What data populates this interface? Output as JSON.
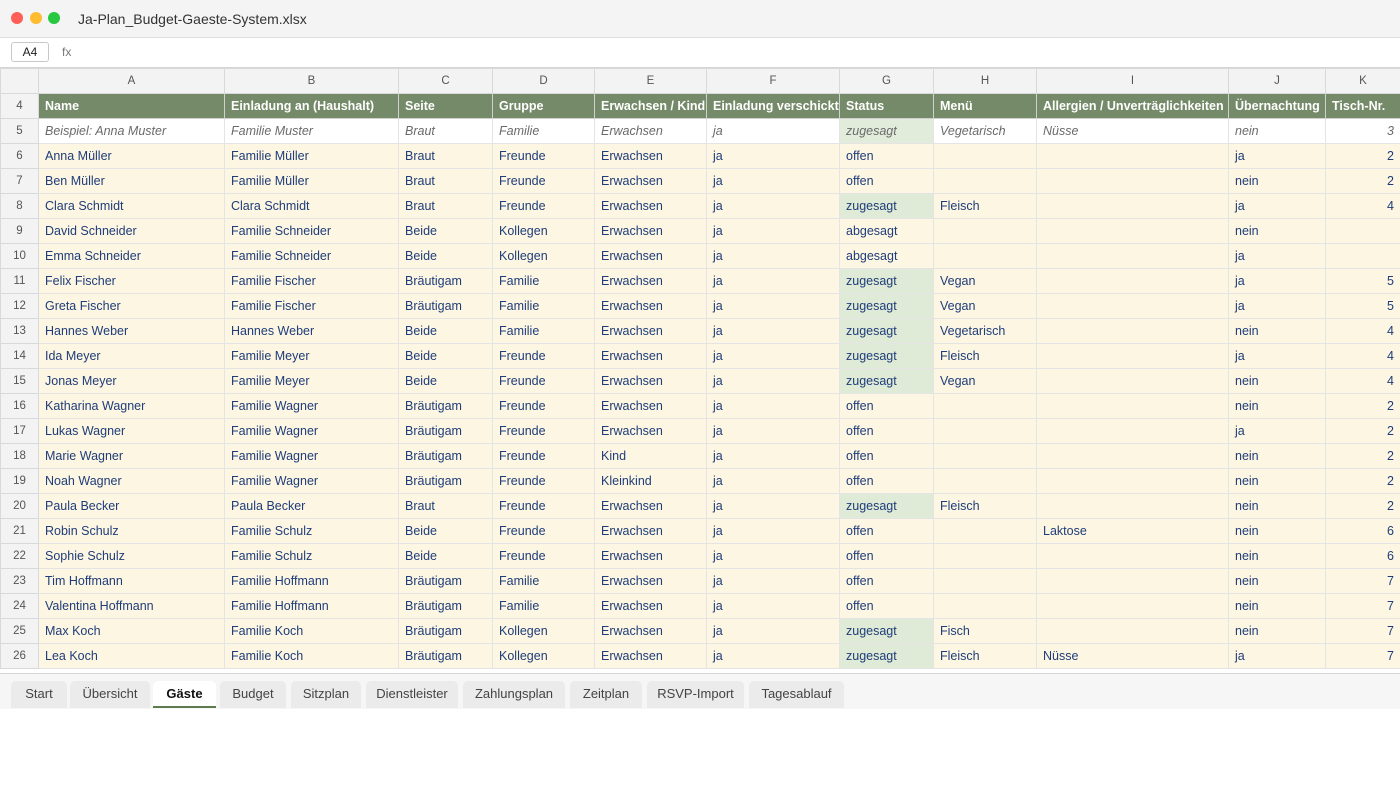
{
  "window": {
    "title": "Ja-Plan_Budget-Gaeste-System.xlsx"
  },
  "formula_bar": {
    "cell_ref": "A4",
    "fx_label": "fx"
  },
  "columns": [
    "A",
    "B",
    "C",
    "D",
    "E",
    "F",
    "G",
    "H",
    "I",
    "J",
    "K"
  ],
  "header_row": {
    "row_number": "4",
    "cells": [
      "Name",
      "Einladung an (Haushalt)",
      "Seite",
      "Gruppe",
      "Erwachsen / Kind",
      "Einladung verschickt",
      "Status",
      "Menü",
      "Allergien / Unverträglichkeiten",
      "Übernachtung",
      "Tisch-Nr."
    ]
  },
  "example_row": {
    "row_number": "5",
    "cells": [
      "Beispiel: Anna Muster",
      "Familie Muster",
      "Braut",
      "Familie",
      "Erwachsen",
      "ja",
      "zugesagt",
      "Vegetarisch",
      "Nüsse",
      "nein",
      "3"
    ]
  },
  "rows": [
    {
      "n": "6",
      "cells": [
        "Anna Müller",
        "Familie Müller",
        "Braut",
        "Freunde",
        "Erwachsen",
        "ja",
        "offen",
        "",
        "",
        "ja",
        "2"
      ]
    },
    {
      "n": "7",
      "cells": [
        "Ben Müller",
        "Familie Müller",
        "Braut",
        "Freunde",
        "Erwachsen",
        "ja",
        "offen",
        "",
        "",
        "nein",
        "2"
      ]
    },
    {
      "n": "8",
      "cells": [
        "Clara Schmidt",
        "Clara Schmidt",
        "Braut",
        "Freunde",
        "Erwachsen",
        "ja",
        "zugesagt",
        "Fleisch",
        "",
        "ja",
        "4"
      ]
    },
    {
      "n": "9",
      "cells": [
        "David Schneider",
        "Familie Schneider",
        "Beide",
        "Kollegen",
        "Erwachsen",
        "ja",
        "abgesagt",
        "",
        "",
        "nein",
        ""
      ]
    },
    {
      "n": "10",
      "cells": [
        "Emma Schneider",
        "Familie Schneider",
        "Beide",
        "Kollegen",
        "Erwachsen",
        "ja",
        "abgesagt",
        "",
        "",
        "ja",
        ""
      ]
    },
    {
      "n": "11",
      "cells": [
        "Felix Fischer",
        "Familie Fischer",
        "Bräutigam",
        "Familie",
        "Erwachsen",
        "ja",
        "zugesagt",
        "Vegan",
        "",
        "ja",
        "5"
      ]
    },
    {
      "n": "12",
      "cells": [
        "Greta Fischer",
        "Familie Fischer",
        "Bräutigam",
        "Familie",
        "Erwachsen",
        "ja",
        "zugesagt",
        "Vegan",
        "",
        "ja",
        "5"
      ]
    },
    {
      "n": "13",
      "cells": [
        "Hannes Weber",
        "Hannes Weber",
        "Beide",
        "Familie",
        "Erwachsen",
        "ja",
        "zugesagt",
        "Vegetarisch",
        "",
        "nein",
        "4"
      ]
    },
    {
      "n": "14",
      "cells": [
        "Ida Meyer",
        "Familie Meyer",
        "Beide",
        "Freunde",
        "Erwachsen",
        "ja",
        "zugesagt",
        "Fleisch",
        "",
        "ja",
        "4"
      ]
    },
    {
      "n": "15",
      "cells": [
        "Jonas Meyer",
        "Familie Meyer",
        "Beide",
        "Freunde",
        "Erwachsen",
        "ja",
        "zugesagt",
        "Vegan",
        "",
        "nein",
        "4"
      ]
    },
    {
      "n": "16",
      "cells": [
        "Katharina Wagner",
        "Familie Wagner",
        "Bräutigam",
        "Freunde",
        "Erwachsen",
        "ja",
        "offen",
        "",
        "",
        "nein",
        "2"
      ]
    },
    {
      "n": "17",
      "cells": [
        "Lukas Wagner",
        "Familie Wagner",
        "Bräutigam",
        "Freunde",
        "Erwachsen",
        "ja",
        "offen",
        "",
        "",
        "ja",
        "2"
      ]
    },
    {
      "n": "18",
      "cells": [
        "Marie Wagner",
        "Familie Wagner",
        "Bräutigam",
        "Freunde",
        "Kind",
        "ja",
        "offen",
        "",
        "",
        "nein",
        "2"
      ]
    },
    {
      "n": "19",
      "cells": [
        "Noah Wagner",
        "Familie Wagner",
        "Bräutigam",
        "Freunde",
        "Kleinkind",
        "ja",
        "offen",
        "",
        "",
        "nein",
        "2"
      ]
    },
    {
      "n": "20",
      "cells": [
        "Paula Becker",
        "Paula Becker",
        "Braut",
        "Freunde",
        "Erwachsen",
        "ja",
        "zugesagt",
        "Fleisch",
        "",
        "nein",
        "2"
      ]
    },
    {
      "n": "21",
      "cells": [
        "Robin Schulz",
        "Familie Schulz",
        "Beide",
        "Freunde",
        "Erwachsen",
        "ja",
        "offen",
        "",
        "Laktose",
        "nein",
        "6"
      ]
    },
    {
      "n": "22",
      "cells": [
        "Sophie Schulz",
        "Familie Schulz",
        "Beide",
        "Freunde",
        "Erwachsen",
        "ja",
        "offen",
        "",
        "",
        "nein",
        "6"
      ]
    },
    {
      "n": "23",
      "cells": [
        "Tim Hoffmann",
        "Familie Hoffmann",
        "Bräutigam",
        "Familie",
        "Erwachsen",
        "ja",
        "offen",
        "",
        "",
        "nein",
        "7"
      ]
    },
    {
      "n": "24",
      "cells": [
        "Valentina Hoffmann",
        "Familie Hoffmann",
        "Bräutigam",
        "Familie",
        "Erwachsen",
        "ja",
        "offen",
        "",
        "",
        "nein",
        "7"
      ]
    },
    {
      "n": "25",
      "cells": [
        "Max Koch",
        "Familie Koch",
        "Bräutigam",
        "Kollegen",
        "Erwachsen",
        "ja",
        "zugesagt",
        "Fisch",
        "",
        "nein",
        "7"
      ]
    },
    {
      "n": "26",
      "cells": [
        "Lea Koch",
        "Familie Koch",
        "Bräutigam",
        "Kollegen",
        "Erwachsen",
        "ja",
        "zugesagt",
        "Fleisch",
        "Nüsse",
        "ja",
        "7"
      ]
    }
  ],
  "sheet_tabs": [
    {
      "label": "Start",
      "active": false
    },
    {
      "label": "Übersicht",
      "active": false
    },
    {
      "label": "Gäste",
      "active": true
    },
    {
      "label": "Budget",
      "active": false
    },
    {
      "label": "Sitzplan",
      "active": false
    },
    {
      "label": "Dienstleister",
      "active": false
    },
    {
      "label": "Zahlungsplan",
      "active": false
    },
    {
      "label": "Zeitplan",
      "active": false
    },
    {
      "label": "RSVP-Import",
      "active": false
    },
    {
      "label": "Tagesablauf",
      "active": false
    }
  ],
  "colors": {
    "header_fill": "#748a68",
    "input_fill": "#fdf6e2",
    "accepted_fill": "#dfebd6",
    "text_blue": "#1f3d7a",
    "active_tab_accent": "#5d7b4f"
  }
}
